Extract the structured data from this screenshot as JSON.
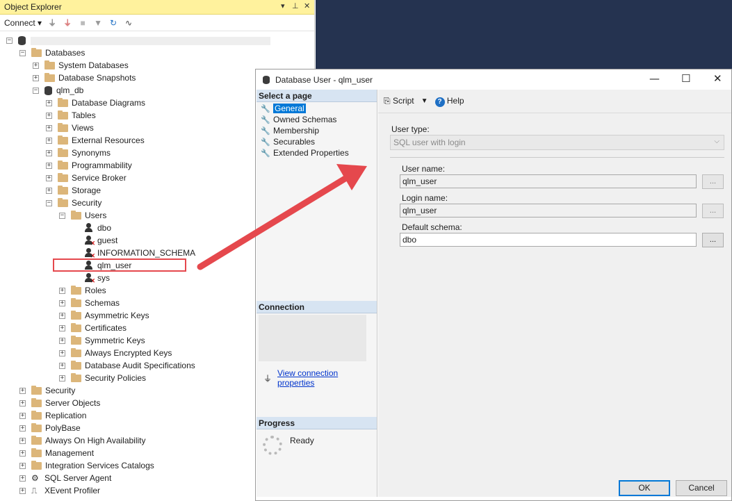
{
  "object_explorer": {
    "title": "Object Explorer",
    "title_controls": [
      "▾",
      "📌",
      "✕"
    ],
    "toolbar": {
      "connect_label": "Connect",
      "connect_arrow": "▾"
    },
    "tree": [
      {
        "label": "",
        "indent": 0,
        "exp": "−",
        "icon": "server"
      },
      {
        "label": "Databases",
        "indent": 1,
        "exp": "−",
        "icon": "folder"
      },
      {
        "label": "System Databases",
        "indent": 2,
        "exp": "+",
        "icon": "folder"
      },
      {
        "label": "Database Snapshots",
        "indent": 2,
        "exp": "+",
        "icon": "folder"
      },
      {
        "label": "qlm_db",
        "indent": 2,
        "exp": "−",
        "icon": "database"
      },
      {
        "label": "Database Diagrams",
        "indent": 3,
        "exp": "+",
        "icon": "folder"
      },
      {
        "label": "Tables",
        "indent": 3,
        "exp": "+",
        "icon": "folder"
      },
      {
        "label": "Views",
        "indent": 3,
        "exp": "+",
        "icon": "folder"
      },
      {
        "label": "External Resources",
        "indent": 3,
        "exp": "+",
        "icon": "folder"
      },
      {
        "label": "Synonyms",
        "indent": 3,
        "exp": "+",
        "icon": "folder"
      },
      {
        "label": "Programmability",
        "indent": 3,
        "exp": "+",
        "icon": "folder"
      },
      {
        "label": "Service Broker",
        "indent": 3,
        "exp": "+",
        "icon": "folder"
      },
      {
        "label": "Storage",
        "indent": 3,
        "exp": "+",
        "icon": "folder"
      },
      {
        "label": "Security",
        "indent": 3,
        "exp": "−",
        "icon": "folder"
      },
      {
        "label": "Users",
        "indent": 4,
        "exp": "−",
        "icon": "folder"
      },
      {
        "label": "dbo",
        "indent": 5,
        "exp": "",
        "icon": "user"
      },
      {
        "label": "guest",
        "indent": 5,
        "exp": "",
        "icon": "user-x"
      },
      {
        "label": "INFORMATION_SCHEMA",
        "indent": 5,
        "exp": "",
        "icon": "user-x"
      },
      {
        "label": "qlm_user",
        "indent": 5,
        "exp": "",
        "icon": "user"
      },
      {
        "label": "sys",
        "indent": 5,
        "exp": "",
        "icon": "user-x"
      },
      {
        "label": "Roles",
        "indent": 4,
        "exp": "+",
        "icon": "folder"
      },
      {
        "label": "Schemas",
        "indent": 4,
        "exp": "+",
        "icon": "folder"
      },
      {
        "label": "Asymmetric Keys",
        "indent": 4,
        "exp": "+",
        "icon": "folder"
      },
      {
        "label": "Certificates",
        "indent": 4,
        "exp": "+",
        "icon": "folder"
      },
      {
        "label": "Symmetric Keys",
        "indent": 4,
        "exp": "+",
        "icon": "folder"
      },
      {
        "label": "Always Encrypted Keys",
        "indent": 4,
        "exp": "+",
        "icon": "folder"
      },
      {
        "label": "Database Audit Specifications",
        "indent": 4,
        "exp": "+",
        "icon": "folder"
      },
      {
        "label": "Security Policies",
        "indent": 4,
        "exp": "+",
        "icon": "folder"
      },
      {
        "label": "Security",
        "indent": 1,
        "exp": "+",
        "icon": "folder"
      },
      {
        "label": "Server Objects",
        "indent": 1,
        "exp": "+",
        "icon": "folder"
      },
      {
        "label": "Replication",
        "indent": 1,
        "exp": "+",
        "icon": "folder"
      },
      {
        "label": "PolyBase",
        "indent": 1,
        "exp": "+",
        "icon": "folder"
      },
      {
        "label": "Always On High Availability",
        "indent": 1,
        "exp": "+",
        "icon": "folder"
      },
      {
        "label": "Management",
        "indent": 1,
        "exp": "+",
        "icon": "folder"
      },
      {
        "label": "Integration Services Catalogs",
        "indent": 1,
        "exp": "+",
        "icon": "folder"
      },
      {
        "label": "SQL Server Agent",
        "indent": 1,
        "exp": "+",
        "icon": "agent"
      },
      {
        "label": "XEvent Profiler",
        "indent": 1,
        "exp": "+",
        "icon": "xevent"
      }
    ]
  },
  "dialog": {
    "title": "Database User - qlm_user",
    "window_controls": {
      "minimize": "—",
      "maximize": "☐",
      "close": "✕"
    },
    "select_page_header": "Select a page",
    "pages": [
      "General",
      "Owned Schemas",
      "Membership",
      "Securables",
      "Extended Properties"
    ],
    "selected_page": "General",
    "connection_header": "Connection",
    "view_connection_link": "View connection properties",
    "progress_header": "Progress",
    "progress_status": "Ready",
    "toolbar": {
      "script_label": "Script",
      "help_label": "Help"
    },
    "form": {
      "user_type_label": "User type:",
      "user_type_value": "SQL user with login",
      "user_name_label": "User name:",
      "user_name_value": "qlm_user",
      "login_name_label": "Login name:",
      "login_name_value": "qlm_user",
      "default_schema_label": "Default schema:",
      "default_schema_value": "dbo",
      "browse_label": "..."
    },
    "ok_label": "OK",
    "cancel_label": "Cancel"
  },
  "colors": {
    "oe_title_bg": "#fff29d",
    "background_dark": "#253350",
    "highlight": "#e5484d",
    "selection": "#0078d7"
  }
}
